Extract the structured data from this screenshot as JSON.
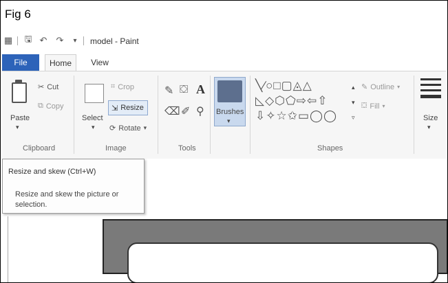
{
  "figure": {
    "label": "Fig 6"
  },
  "window": {
    "title": "model - Paint"
  },
  "tabs": [
    {
      "label": "File"
    },
    {
      "label": "Home"
    },
    {
      "label": "View"
    }
  ],
  "ribbon": {
    "clipboard": {
      "paste": "Paste",
      "cut": "Cut",
      "copy": "Copy",
      "group": "Clipboard"
    },
    "image": {
      "select": "Select",
      "crop": "Crop",
      "resize": "Resize",
      "rotate": "Rotate",
      "group": "Image"
    },
    "tools": {
      "group": "Tools",
      "text_tool": "A"
    },
    "brushes": {
      "label": "Brushes"
    },
    "shapes": {
      "outline": "Outline",
      "fill": "Fill",
      "group": "Shapes"
    },
    "size": {
      "label": "Size"
    }
  },
  "tooltip": {
    "title": "Resize and skew (Ctrl+W)",
    "description": "Resize and skew the picture or selection."
  }
}
